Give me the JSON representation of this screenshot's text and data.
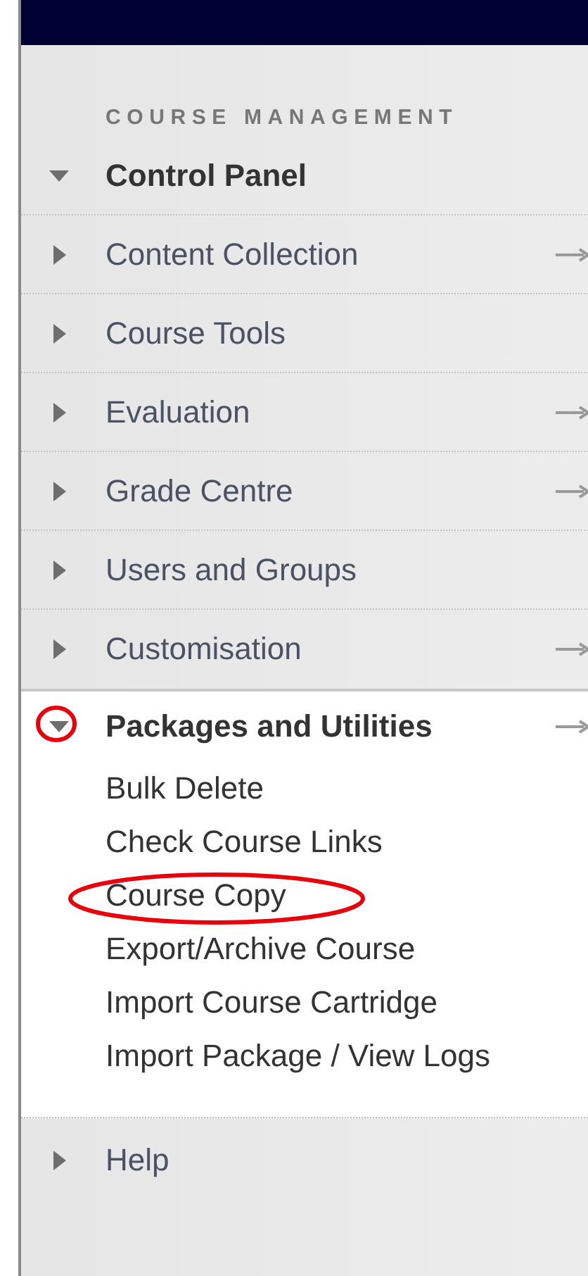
{
  "section_title": "COURSE MANAGEMENT",
  "menu": [
    {
      "label": "Control Panel",
      "expanded": true,
      "link_arrow": false,
      "highlighted": false
    },
    {
      "label": "Content Collection",
      "expanded": false,
      "link_arrow": true,
      "highlighted": false
    },
    {
      "label": "Course Tools",
      "expanded": false,
      "link_arrow": false,
      "highlighted": false
    },
    {
      "label": "Evaluation",
      "expanded": false,
      "link_arrow": true,
      "highlighted": false
    },
    {
      "label": "Grade Centre",
      "expanded": false,
      "link_arrow": true,
      "highlighted": false
    },
    {
      "label": "Users and Groups",
      "expanded": false,
      "link_arrow": false,
      "highlighted": false
    },
    {
      "label": "Customisation",
      "expanded": false,
      "link_arrow": true,
      "highlighted": false
    },
    {
      "label": "Packages and Utilities",
      "expanded": true,
      "link_arrow": true,
      "highlighted": true,
      "children": [
        {
          "label": "Bulk Delete",
          "highlighted": false
        },
        {
          "label": "Check Course Links",
          "highlighted": false
        },
        {
          "label": "Course Copy",
          "highlighted": true
        },
        {
          "label": "Export/Archive Course",
          "highlighted": false
        },
        {
          "label": "Import Course Cartridge",
          "highlighted": false
        },
        {
          "label": "Import Package / View Logs",
          "highlighted": false
        }
      ]
    },
    {
      "label": "Help",
      "expanded": false,
      "link_arrow": false,
      "highlighted": false
    }
  ]
}
